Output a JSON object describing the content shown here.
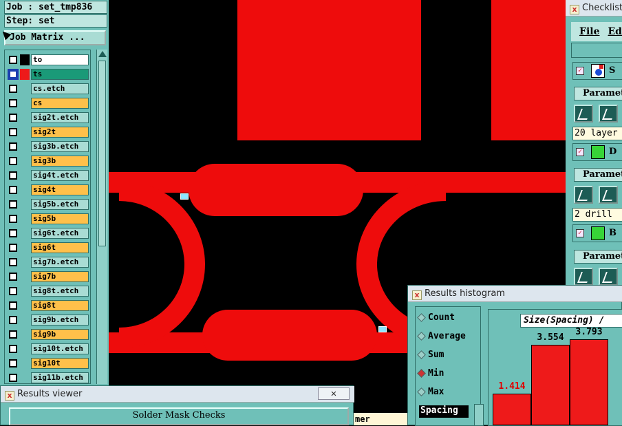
{
  "left_panel": {
    "job": "Job : set_tmp836",
    "step": "Step: set",
    "job_matrix": "Job Matrix ...",
    "layers": [
      {
        "name": "to",
        "bg": "#ffffff",
        "swatch": "#000000"
      },
      {
        "name": "ts",
        "bg": "#1a9a78",
        "swatch": "#ee1a1a",
        "active": true
      },
      {
        "name": "cs.etch",
        "bg": "#a9dcd4",
        "swatch": ""
      },
      {
        "name": "cs",
        "bg": "#ffc04a",
        "swatch": ""
      },
      {
        "name": "sig2t.etch",
        "bg": "#a9dcd4",
        "swatch": ""
      },
      {
        "name": "sig2t",
        "bg": "#ffc04a",
        "swatch": ""
      },
      {
        "name": "sig3b.etch",
        "bg": "#a9dcd4",
        "swatch": ""
      },
      {
        "name": "sig3b",
        "bg": "#ffc04a",
        "swatch": ""
      },
      {
        "name": "sig4t.etch",
        "bg": "#a9dcd4",
        "swatch": ""
      },
      {
        "name": "sig4t",
        "bg": "#ffc04a",
        "swatch": ""
      },
      {
        "name": "sig5b.etch",
        "bg": "#a9dcd4",
        "swatch": ""
      },
      {
        "name": "sig5b",
        "bg": "#ffc04a",
        "swatch": ""
      },
      {
        "name": "sig6t.etch",
        "bg": "#a9dcd4",
        "swatch": ""
      },
      {
        "name": "sig6t",
        "bg": "#ffc04a",
        "swatch": ""
      },
      {
        "name": "sig7b.etch",
        "bg": "#a9dcd4",
        "swatch": ""
      },
      {
        "name": "sig7b",
        "bg": "#ffc04a",
        "swatch": ""
      },
      {
        "name": "sig8t.etch",
        "bg": "#a9dcd4",
        "swatch": ""
      },
      {
        "name": "sig8t",
        "bg": "#ffc04a",
        "swatch": ""
      },
      {
        "name": "sig9b.etch",
        "bg": "#a9dcd4",
        "swatch": ""
      },
      {
        "name": "sig9b",
        "bg": "#ffc04a",
        "swatch": ""
      },
      {
        "name": "sig10t.etch",
        "bg": "#a9dcd4",
        "swatch": ""
      },
      {
        "name": "sig10t",
        "bg": "#ffc04a",
        "swatch": ""
      },
      {
        "name": "sig11b.etch",
        "bg": "#a9dcd4",
        "swatch": ""
      }
    ]
  },
  "checklist": {
    "title": "Checklist",
    "menu": {
      "file": "File",
      "edit": "Edi"
    },
    "rows": [
      {
        "label": "S",
        "param": "Paramete",
        "note": "20 layer"
      },
      {
        "label": "D",
        "param": "Paramete",
        "note": "2 drill"
      },
      {
        "label": "B",
        "param": "Paramete",
        "note": ""
      }
    ]
  },
  "histogram": {
    "title": "Results histogram",
    "options": [
      {
        "label": "Count",
        "selected": false
      },
      {
        "label": "Average",
        "selected": false
      },
      {
        "label": "Sum",
        "selected": false
      },
      {
        "label": "Min",
        "selected": true
      },
      {
        "label": "Max",
        "selected": false
      }
    ],
    "plot_title": "Size(Spacing) / ",
    "field": "Spacing"
  },
  "chart_data": {
    "type": "bar",
    "title": "Size(Spacing) / ",
    "values": [
      1.414,
      3.554,
      3.793
    ],
    "value_labels": [
      "1.414",
      "3.554",
      "3.793"
    ],
    "label_colors": [
      "#e00000",
      "#000000",
      "#000000"
    ],
    "ylim": [
      0,
      4.2
    ]
  },
  "results_viewer": {
    "title": "Results viewer",
    "close": "✕",
    "check_name": "Solder Mask Checks"
  },
  "canvas_tag": "mer",
  "colors": {
    "copper": "#ee0c0c",
    "panel": "#6fc0b8",
    "background": "#000000"
  }
}
